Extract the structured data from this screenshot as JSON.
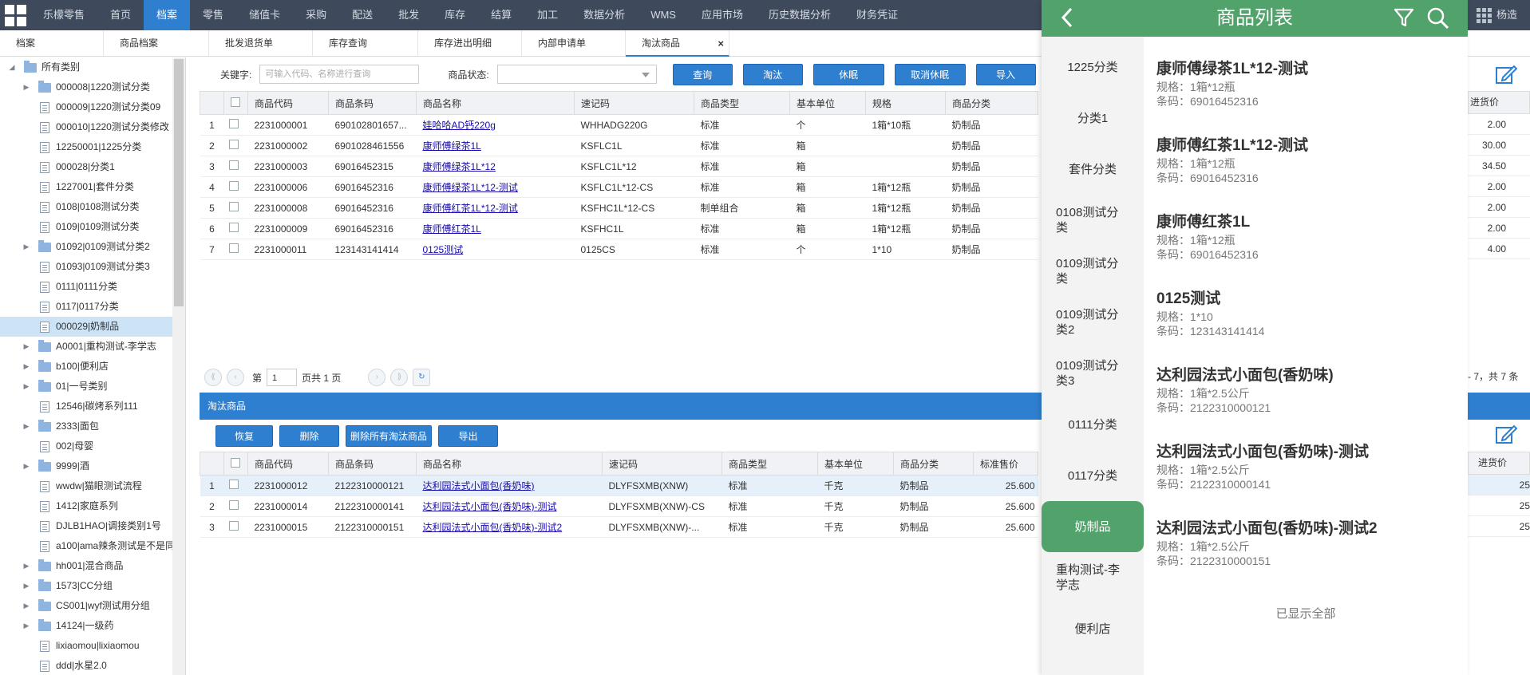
{
  "topnav": {
    "items": [
      "乐檬零售",
      "首页",
      "档案",
      "零售",
      "储值卡",
      "采购",
      "配送",
      "批发",
      "库存",
      "结算",
      "加工",
      "数据分析",
      "WMS",
      "应用市场",
      "历史数据分析",
      "财务凭证"
    ],
    "active_index": 2,
    "user": "杨造"
  },
  "tabs": [
    "档案",
    "商品档案",
    "批发退货单",
    "库存查询",
    "库存进出明细",
    "内部申请单",
    "淘汰商品"
  ],
  "active_tab_close": "×",
  "tree": [
    {
      "label": "所有类别",
      "type": "root"
    },
    {
      "label": "000008|1220测试分类",
      "type": "folder"
    },
    {
      "label": "000009|1220测试分类09",
      "type": "doc"
    },
    {
      "label": "000010|1220测试分类修改",
      "type": "doc"
    },
    {
      "label": "12250001|1225分类",
      "type": "doc"
    },
    {
      "label": "000028|分类1",
      "type": "doc"
    },
    {
      "label": "1227001|套件分类",
      "type": "doc"
    },
    {
      "label": "0108|0108测试分类",
      "type": "doc"
    },
    {
      "label": "0109|0109测试分类",
      "type": "doc"
    },
    {
      "label": "01092|0109测试分类2",
      "type": "folder"
    },
    {
      "label": "01093|0109测试分类3",
      "type": "doc"
    },
    {
      "label": "0111|0111分类",
      "type": "doc"
    },
    {
      "label": "0117|0117分类",
      "type": "doc"
    },
    {
      "label": "000029|奶制品",
      "type": "doc",
      "selected": true
    },
    {
      "label": "A0001|重构测试-李学志",
      "type": "folder"
    },
    {
      "label": "b100|便利店",
      "type": "folder"
    },
    {
      "label": "01|一号类别",
      "type": "folder"
    },
    {
      "label": "12546|碳烤系列111",
      "type": "doc"
    },
    {
      "label": "2333|面包",
      "type": "folder"
    },
    {
      "label": "002|母婴",
      "type": "doc"
    },
    {
      "label": "9999|酒",
      "type": "folder"
    },
    {
      "label": "wwdw|猫眼测试流程",
      "type": "doc"
    },
    {
      "label": "1412|家庭系列",
      "type": "doc"
    },
    {
      "label": "DJLB1HAO|调接类别1号",
      "type": "doc"
    },
    {
      "label": "a100|ama辣条测试是不是同",
      "type": "doc"
    },
    {
      "label": "hh001|混合商品",
      "type": "folder"
    },
    {
      "label": "1573|CC分组",
      "type": "folder"
    },
    {
      "label": "CS001|wyf测试用分组",
      "type": "folder"
    },
    {
      "label": "14124|一级药",
      "type": "folder"
    },
    {
      "label": "lixiaomou|lixiaomou",
      "type": "doc"
    },
    {
      "label": "ddd|水星2.0",
      "type": "doc"
    }
  ],
  "search": {
    "keyword_label": "关键字:",
    "keyword_placeholder": "可输入代码、名称进行查询",
    "status_label": "商品状态:",
    "buttons": [
      "查询",
      "淘汰",
      "休眠",
      "取消休眠",
      "导入"
    ]
  },
  "table1": {
    "headers": [
      "",
      "商品代码",
      "商品条码",
      "商品名称",
      "速记码",
      "商品类型",
      "基本单位",
      "规格",
      "商品分类"
    ],
    "right_header": "进货价",
    "rows": [
      {
        "n": "1",
        "code": "2231000001",
        "barcode": "690102801657...",
        "name": "娃哈哈AD钙220g",
        "short": "WHHADG220G",
        "type": "标准",
        "unit": "个",
        "spec": "1箱*10瓶",
        "cat": "奶制品",
        "price": "2.00"
      },
      {
        "n": "2",
        "code": "2231000002",
        "barcode": "6901028461556",
        "name": "康师傅绿茶1L",
        "short": "KSFLC1L",
        "type": "标准",
        "unit": "箱",
        "spec": "",
        "cat": "奶制品",
        "price": "30.00"
      },
      {
        "n": "3",
        "code": "2231000003",
        "barcode": "69016452315",
        "name": "康师傅绿茶1L*12",
        "short": "KSFLC1L*12",
        "type": "标准",
        "unit": "箱",
        "spec": "",
        "cat": "奶制品",
        "price": "34.50"
      },
      {
        "n": "4",
        "code": "2231000006",
        "barcode": "69016452316",
        "name": "康师傅绿茶1L*12-测试",
        "short": "KSFLC1L*12-CS",
        "type": "标准",
        "unit": "箱",
        "spec": "1箱*12瓶",
        "cat": "奶制品",
        "price": "2.00"
      },
      {
        "n": "5",
        "code": "2231000008",
        "barcode": "69016452316",
        "name": "康师傅红茶1L*12-测试",
        "short": "KSFHC1L*12-CS",
        "type": "制单组合",
        "unit": "箱",
        "spec": "1箱*12瓶",
        "cat": "奶制品",
        "price": "2.00"
      },
      {
        "n": "6",
        "code": "2231000009",
        "barcode": "69016452316",
        "name": "康师傅红茶1L",
        "short": "KSFHC1L",
        "type": "标准",
        "unit": "箱",
        "spec": "1箱*12瓶",
        "cat": "奶制品",
        "price": "2.00"
      },
      {
        "n": "7",
        "code": "2231000011",
        "barcode": "123143141414",
        "name": "0125测试",
        "short": "0125CS",
        "type": "标准",
        "unit": "个",
        "spec": "1*10",
        "cat": "奶制品",
        "price": "4.00"
      }
    ]
  },
  "pager": {
    "page_prefix": "第",
    "page_value": "1",
    "page_suffix": "页共 1 页",
    "summary": "- 7，共 7 条"
  },
  "section_title": "淘汰商品",
  "section_buttons": [
    "恢复",
    "删除",
    "删除所有淘汰商品",
    "导出"
  ],
  "table2": {
    "headers": [
      "",
      "商品代码",
      "商品条码",
      "商品名称",
      "速记码",
      "商品类型",
      "基本单位",
      "商品分类",
      "标准售价"
    ],
    "right_header": "进货价",
    "rows": [
      {
        "n": "1",
        "code": "2231000012",
        "barcode": "2122310000121",
        "name": "达利园法式小面包(香奶味)",
        "short": "DLYFSXMB(XNW)",
        "type": "标准",
        "unit": "千克",
        "cat": "奶制品",
        "sale": "25.600",
        "price": "25"
      },
      {
        "n": "2",
        "code": "2231000014",
        "barcode": "2122310000141",
        "name": "达利园法式小面包(香奶味)-测试",
        "short": "DLYFSXMB(XNW)-CS",
        "type": "标准",
        "unit": "千克",
        "cat": "奶制品",
        "sale": "25.600",
        "price": "25"
      },
      {
        "n": "3",
        "code": "2231000015",
        "barcode": "2122310000151",
        "name": "达利园法式小面包(香奶味)-测试2",
        "short": "DLYFSXMB(XNW)-...",
        "type": "标准",
        "unit": "千克",
        "cat": "奶制品",
        "sale": "25.600",
        "price": "25"
      }
    ]
  },
  "overlay": {
    "title": "商品列表",
    "categories": [
      "1225分类",
      "分类1",
      "套件分类",
      "0108测试分类",
      "0109测试分类",
      "0109测试分类2",
      "0109测试分类3",
      "0111分类",
      "0117分类",
      "奶制品",
      "重构测试-李学志",
      "便利店"
    ],
    "active_category": "奶制品",
    "products": [
      {
        "name": "康师傅绿茶1L*12-测试",
        "spec": "规格：1箱*12瓶",
        "barcode": "条码：69016452316"
      },
      {
        "name": "康师傅红茶1L*12-测试",
        "spec": "规格：1箱*12瓶",
        "barcode": "条码：69016452316"
      },
      {
        "name": "康师傅红茶1L",
        "spec": "规格：1箱*12瓶",
        "barcode": "条码：69016452316"
      },
      {
        "name": "0125测试",
        "spec": "规格：1*10",
        "barcode": "条码：123143141414"
      },
      {
        "name": "达利园法式小面包(香奶味)",
        "spec": "规格：1箱*2.5公斤",
        "barcode": "条码：2122310000121"
      },
      {
        "name": "达利园法式小面包(香奶味)-测试",
        "spec": "规格：1箱*2.5公斤",
        "barcode": "条码：2122310000141"
      },
      {
        "name": "达利园法式小面包(香奶味)-测试2",
        "spec": "规格：1箱*2.5公斤",
        "barcode": "条码：2122310000151"
      }
    ],
    "all_shown": "已显示全部"
  },
  "colors": {
    "nav_bg": "#3e4a5b",
    "accent_blue": "#2f7fd0",
    "overlay_green": "#52a36b"
  },
  "icons": [
    "app-grid-icon",
    "user-grid-icon",
    "back-arrow-icon",
    "filter-icon",
    "search-icon",
    "edit-icon",
    "folder-icon",
    "document-icon",
    "tree-arrow-icon",
    "refresh-icon"
  ]
}
